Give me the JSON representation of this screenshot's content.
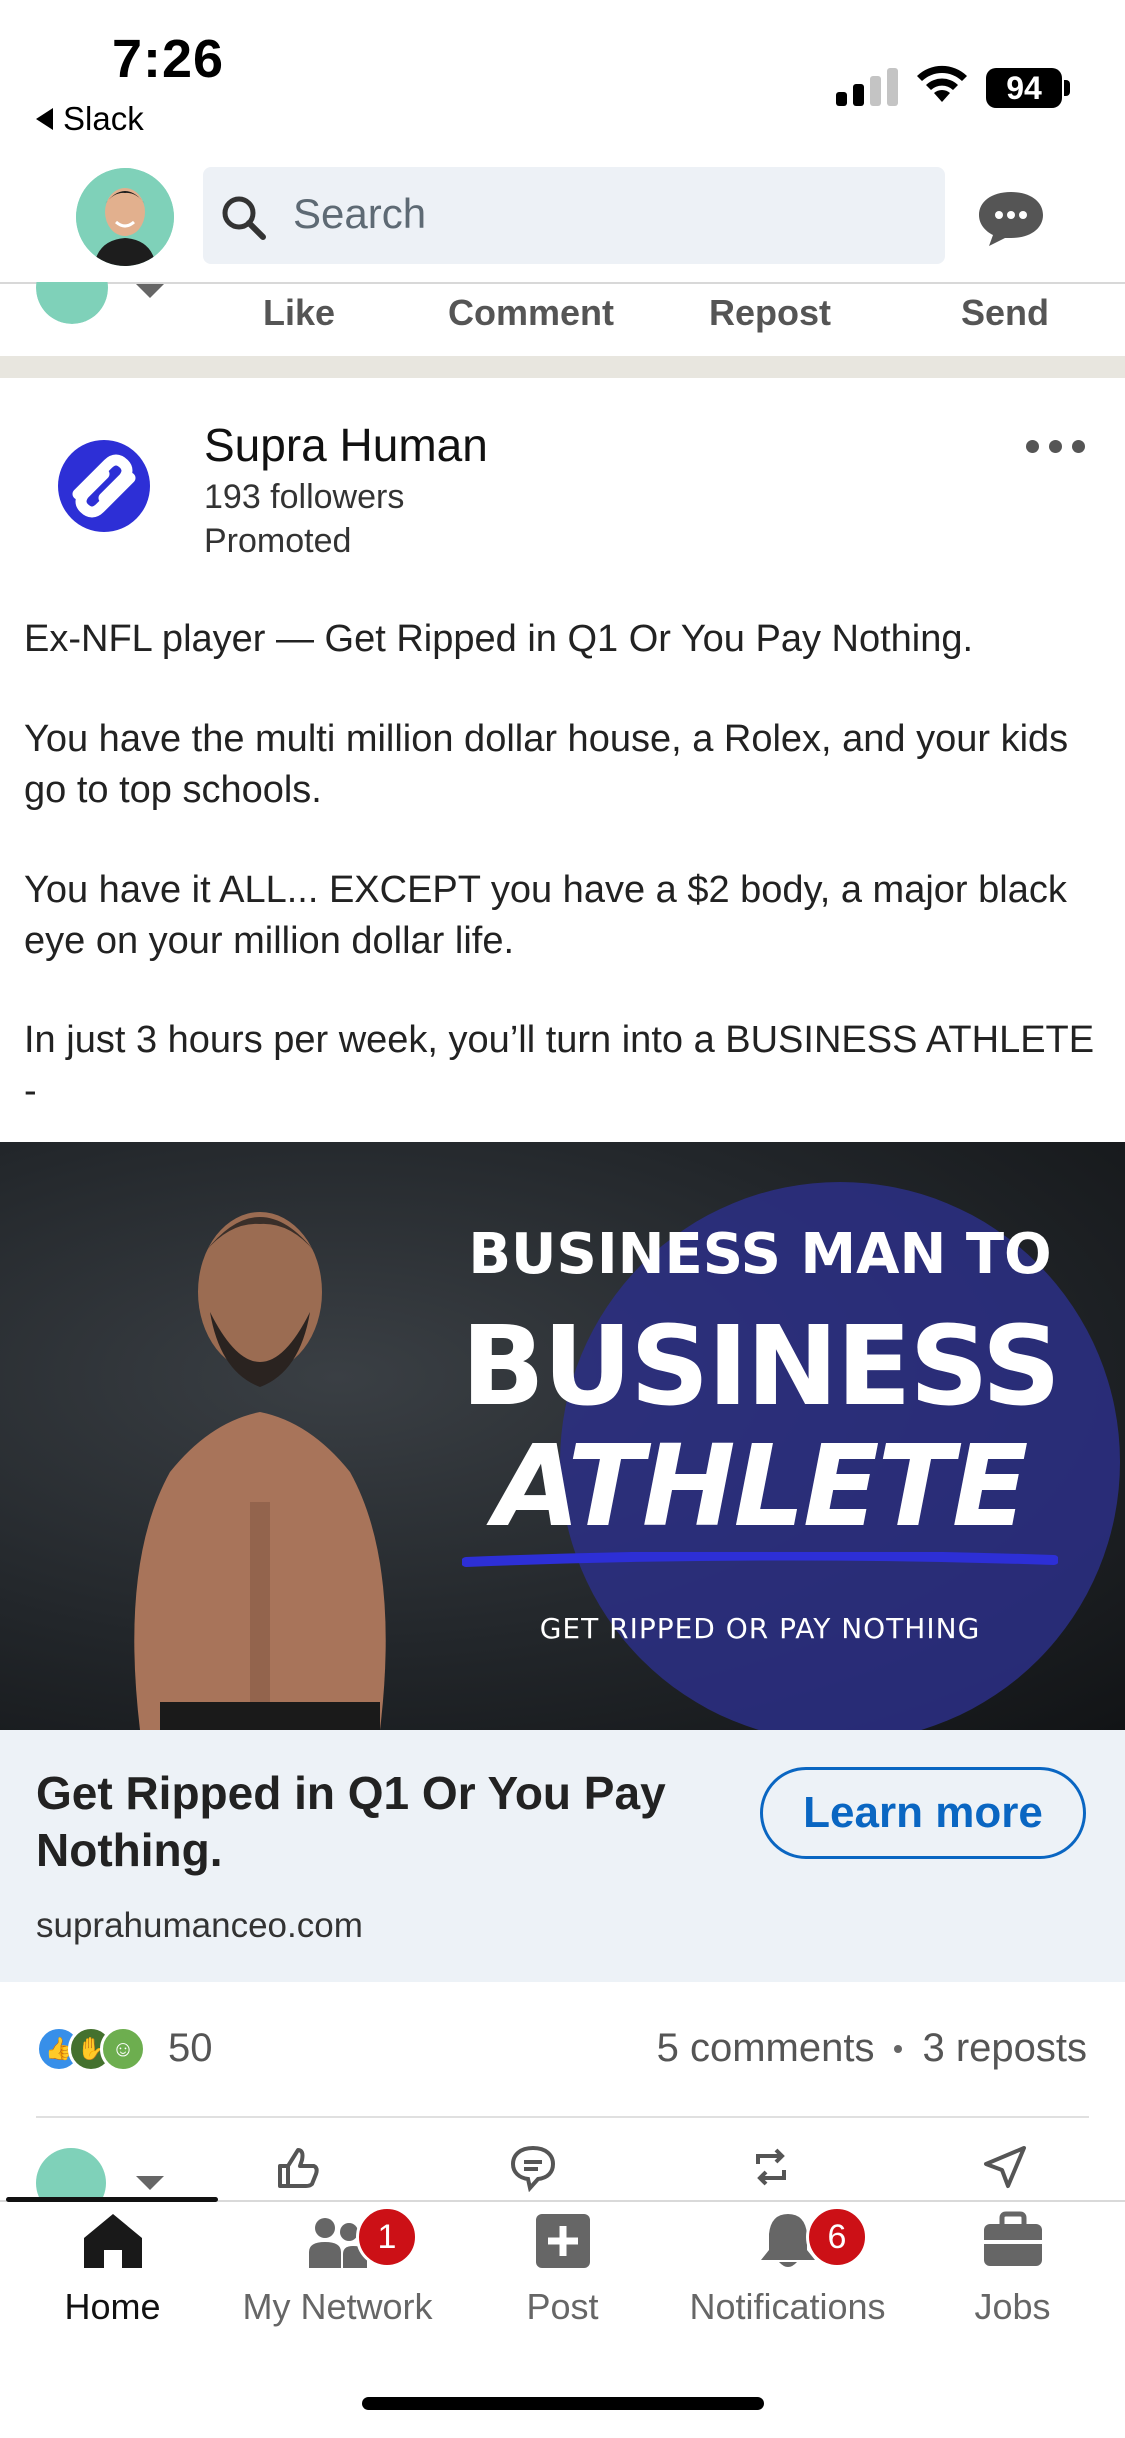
{
  "status_bar": {
    "time": "7:26",
    "back_app": "Slack",
    "battery": "94"
  },
  "header": {
    "search_placeholder": "Search"
  },
  "top_actions": [
    {
      "label": "Like"
    },
    {
      "label": "Comment"
    },
    {
      "label": "Repost"
    },
    {
      "label": "Send"
    }
  ],
  "post": {
    "company": "Supra Human",
    "followers": "193 followers",
    "promoted": "Promoted",
    "paragraphs": [
      "Ex-NFL player — Get Ripped in Q1 Or You Pay Nothing.",
      "You have the multi million dollar house, a Rolex, and your kids go to top schools.",
      "You have it ALL... EXCEPT you have a $2 body, a major black eye on your million dollar life.",
      "In just 3 hours per week, you’ll turn into a BUSINESS ATHLETE -"
    ],
    "ad_image": {
      "line1": "BUSINESS MAN TO",
      "line2": "BUSINESS",
      "line3": "ATHLETE",
      "line4": "GET RIPPED OR PAY NOTHING"
    },
    "cta": {
      "title": "Get Ripped in Q1 Or You Pay Nothing.",
      "url": "suprahumanceo.com",
      "button": "Learn more"
    },
    "reaction_count": "50",
    "comments": "5 comments",
    "reposts": "3 reposts"
  },
  "tabs": [
    {
      "label": "Home",
      "icon": "home-icon",
      "active": true
    },
    {
      "label": "My Network",
      "icon": "network-icon",
      "badge": "1"
    },
    {
      "label": "Post",
      "icon": "post-icon"
    },
    {
      "label": "Notifications",
      "icon": "bell-icon",
      "badge": "6"
    },
    {
      "label": "Jobs",
      "icon": "briefcase-icon"
    }
  ],
  "colors": {
    "accent": "#0a66c2",
    "badge": "#cc1016",
    "brand_logo": "#2d2fd6"
  }
}
